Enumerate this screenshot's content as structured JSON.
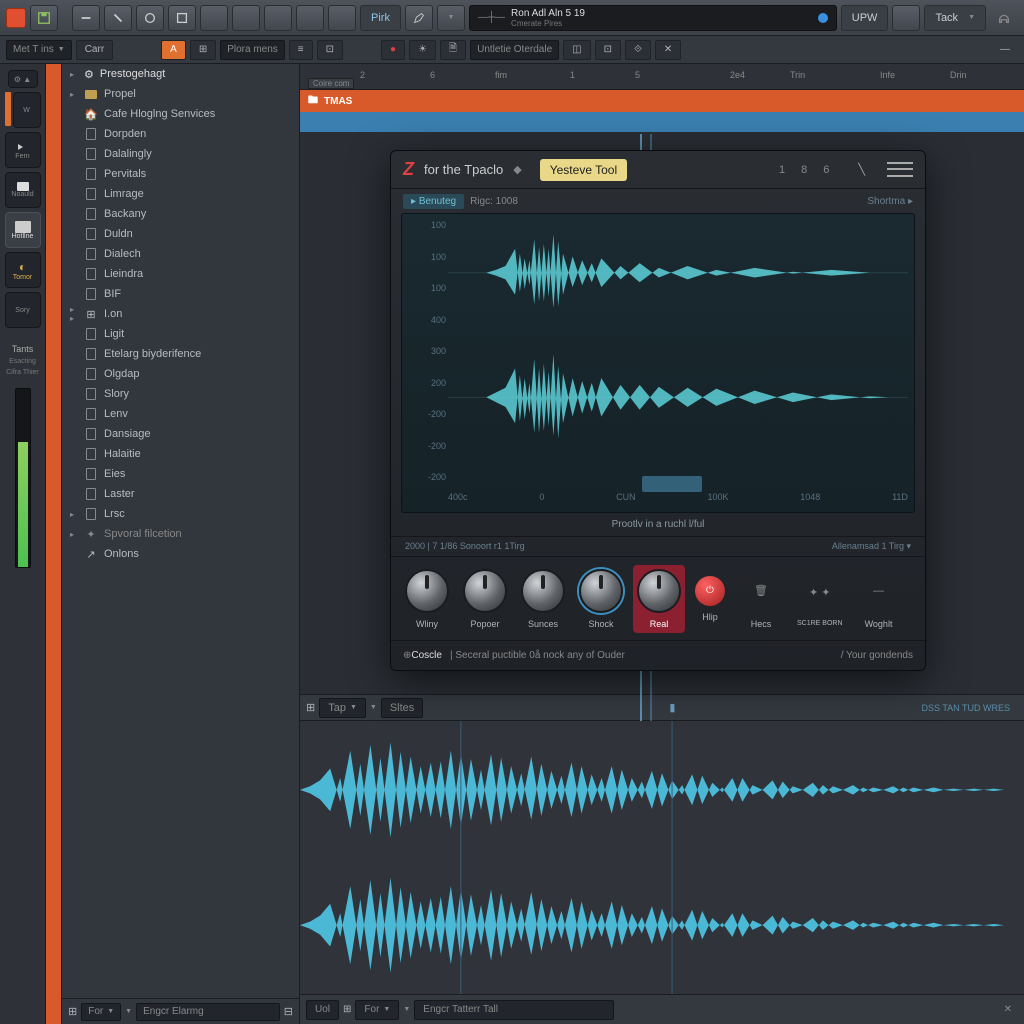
{
  "toolbar": {
    "pink_label": "Pirk",
    "tempo_label": "Ron Adl Aln 5 19",
    "tempo_sub": "Cmerate Pires",
    "upw": "UPW",
    "tack": "Tack"
  },
  "secbar": {
    "met": "Met T ins",
    "pref": "Plora mens",
    "untitle": "Untletie Oterdale"
  },
  "rail": {
    "items": [
      "W",
      "Fern",
      "Noauld",
      "Hotllne",
      "Tomor",
      "Sory"
    ],
    "tants": "Tants",
    "tants_sub1": "Esacting",
    "tants_sub2": "Cifra Thier"
  },
  "browser": {
    "header": "Prestogehagt",
    "items": [
      "Propel",
      "Cafe Hloglng Senvices",
      "Dorpden",
      "Dalalingly",
      "Pervitals",
      "Limrage",
      "Backany",
      "Duldn",
      "Dialech",
      "Lieindra",
      "BIF",
      "I.on",
      "Ligit",
      "Etelarg biyderifence",
      "Olgdap",
      "Slory",
      "Lenv",
      "Dansiage",
      "Halaitie",
      "Eies",
      "Laster",
      "Lrsc",
      "Spvoral filcetion",
      "Onlons"
    ],
    "footer_for": "For",
    "footer_enger": "Engcr Elarmg"
  },
  "ruler": {
    "ticks": [
      "2",
      "6",
      "fim",
      "1",
      "5",
      "2e4",
      "Trin",
      "Infe",
      "Drin"
    ],
    "coire": "Coire com",
    "tmas": "TMAS"
  },
  "plugin": {
    "title": "for the Tpaclo",
    "tool": "Yesteve Tool",
    "nums": [
      "1",
      "8",
      "6"
    ],
    "sub_pill": "Benuteg",
    "sub_pill2": "Rigc: 1008",
    "sub_right": "Shortma",
    "y_ticks": [
      "100",
      "100",
      "100",
      "400",
      "300",
      "200",
      "-200",
      "-200",
      "-200"
    ],
    "x_ticks": [
      "400c",
      "0",
      "CUN",
      "100K",
      "1048",
      "11D"
    ],
    "caption": "Prootlv in a ruchl l/ful",
    "knob_info": "2000 | 7 1/86 Sonoort r1 1Tirg",
    "knob_info_right": "Allenamsad 1 Tirg",
    "knobs": [
      "Wliny",
      "Popoer",
      "Sunces",
      "Shock",
      "Real",
      "Hlip",
      "Hecs",
      "SC1RE",
      "BORN",
      "Woghlt"
    ],
    "footer_left": "Coscle",
    "footer_text": "| Seceral puctible 0å nock any of Ouder",
    "footer_right": "/ Your gondends"
  },
  "bottom": {
    "tap": "Tap",
    "slices": "Sltes",
    "label_right": "DSS TAN TUD WRES"
  },
  "status": {
    "uol": "Uol",
    "for": "For",
    "enger": "Engcr Tatterr Tall"
  }
}
